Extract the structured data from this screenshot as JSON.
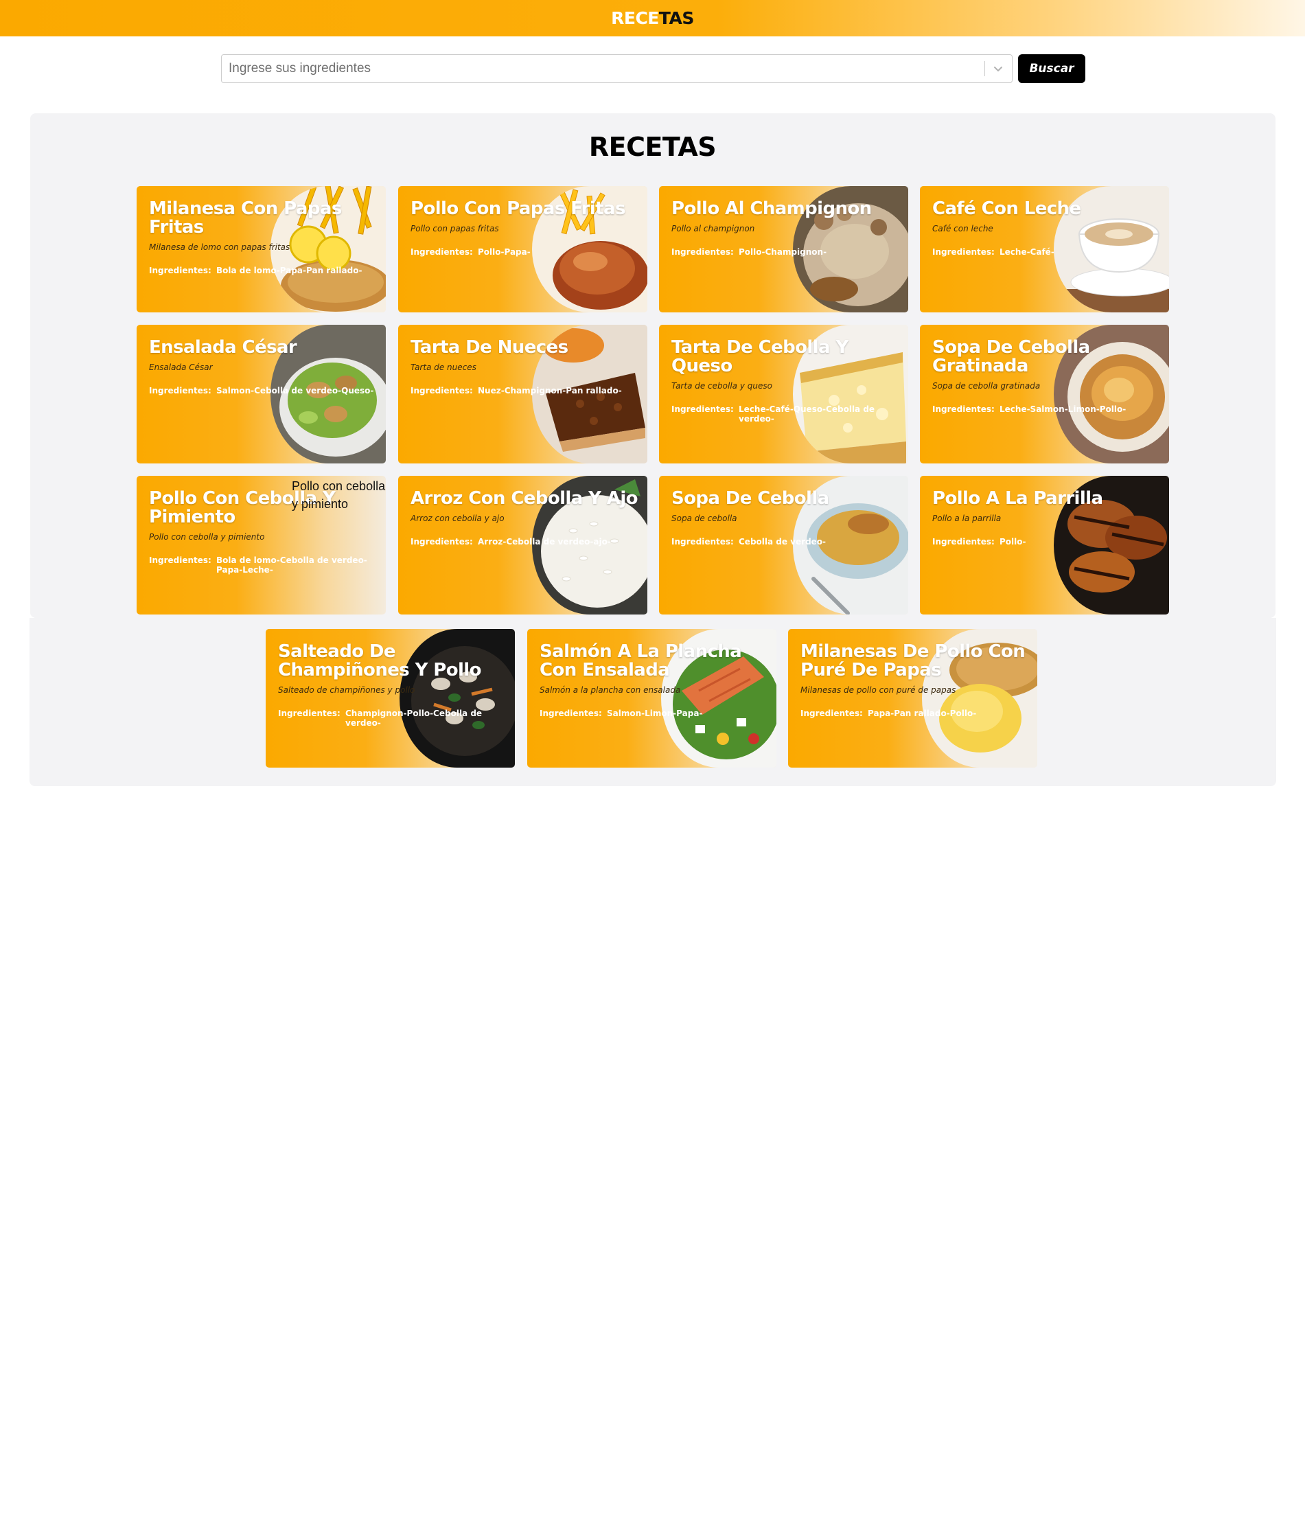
{
  "header": {
    "logo_part1": "RECE",
    "logo_part2": "TAS"
  },
  "search": {
    "placeholder": "Ingrese sus ingredientes",
    "button_label": "Buscar"
  },
  "section": {
    "title": "RECETAS"
  },
  "ingredients_label": "Ingredientes:",
  "recipes": [
    {
      "title": "Milanesa Con Papas Fritas",
      "description": "Milanesa de lomo con papas fritas",
      "ingredients": "Bola de lomo-Papa-Pan rallado-",
      "image": "fries-icon"
    },
    {
      "title": "Pollo Con Papas Fritas",
      "description": "Pollo con papas fritas",
      "ingredients": "Pollo-Papa-",
      "image": "roast-chicken-icon"
    },
    {
      "title": "Pollo Al Champignon",
      "description": "Pollo al champignon",
      "ingredients": "Pollo-Champignon-",
      "image": "chicken-mushroom-icon"
    },
    {
      "title": "Café Con Leche",
      "description": "Café con leche",
      "ingredients": "Leche-Café-",
      "image": "coffee-cup-icon"
    },
    {
      "title": "Ensalada César",
      "description": "Ensalada César",
      "ingredients": "Salmon-Cebolla de verdeo-Queso-",
      "image": "salad-icon"
    },
    {
      "title": "Tarta De Nueces",
      "description": "Tarta de nueces",
      "ingredients": "Nuez-Champignon-Pan rallado-",
      "image": "pie-icon"
    },
    {
      "title": "Tarta De Cebolla Y Queso",
      "description": "Tarta de cebolla y queso",
      "ingredients": "Leche-Café-Queso-Cebolla de verdeo-",
      "image": "quiche-icon"
    },
    {
      "title": "Sopa De Cebolla Gratinada",
      "description": "Sopa de cebolla gratinada",
      "ingredients": "Leche-Salmon-Limon-Pollo-",
      "image": "gratin-soup-icon"
    },
    {
      "title": "Pollo Con Cebolla Y Pimiento",
      "description": "Pollo con cebolla y pimiento",
      "ingredients": "Bola de lomo-Cebolla de verdeo-Papa-Leche-",
      "image": ""
    },
    {
      "title": "Arroz Con Cebolla Y Ajo",
      "description": "Arroz con cebolla y ajo",
      "ingredients": "Arroz-Cebolla de verdeo-ajo-",
      "image": "rice-icon"
    },
    {
      "title": "Sopa De Cebolla",
      "description": "Sopa de cebolla",
      "ingredients": "Cebolla de verdeo-",
      "image": "soup-bowl-icon"
    },
    {
      "title": "Pollo A La Parrilla",
      "description": "Pollo a la parrilla",
      "ingredients": "Pollo-",
      "image": "grilled-chicken-icon"
    },
    {
      "title": "Salteado De Champiñones Y Pollo",
      "description": "Salteado de champiñones y pollo",
      "ingredients": "Champignon-Pollo-Cebolla de verdeo-",
      "image": "stir-fry-icon"
    },
    {
      "title": "Salmón A La Plancha Con Ensalada",
      "description": "Salmón a la plancha con ensalada",
      "ingredients": "Salmon-Limon-Papa-",
      "image": "salmon-salad-icon"
    },
    {
      "title": "Milanesas De Pollo Con Puré De Papas",
      "description": "Milanesas de pollo con puré de papas",
      "ingredients": "Papa-Pan rallado-Pollo-",
      "image": "mashed-potatoes-icon"
    }
  ],
  "broken_image_alt": "Pollo con cebolla y pimiento",
  "colors": {
    "accent": "#fba900",
    "panel": "#f3f3f5",
    "button": "#000000"
  }
}
